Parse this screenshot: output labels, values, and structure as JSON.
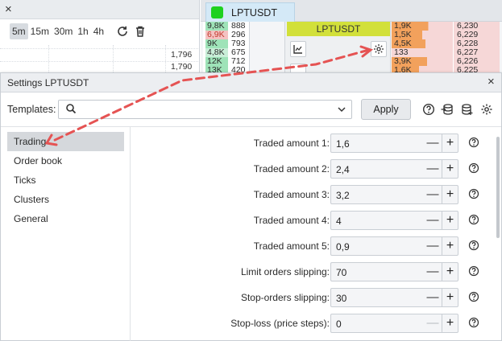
{
  "background": {
    "chart": {
      "close_glyph": "×",
      "timeframes": [
        "5m",
        "15m",
        "30m",
        "1h",
        "4h"
      ],
      "active_timeframe": "5m",
      "price_labels": [
        "1,796",
        "1,790"
      ]
    },
    "dom": {
      "tab_label": "LPTUSDT",
      "tab_color": "#1fd11f",
      "left_rows": [
        {
          "a": "9,8K",
          "b": "888",
          "bg": "#9ee3b8"
        },
        {
          "a": "6,9K",
          "b": "296",
          "bg": "#f4c2c2",
          "color": "#c0392b"
        },
        {
          "a": "9K",
          "b": "793",
          "bg": "#9ee3b8"
        },
        {
          "a": "4,8K",
          "b": "675",
          "bg": "#c9eed8"
        },
        {
          "a": "12K",
          "b": "712",
          "bg": "#9ee3b8"
        },
        {
          "a": "13K",
          "b": "420",
          "bg": "#9ee3b8"
        }
      ],
      "mid_title": "LPTUSDT",
      "right_rows": [
        {
          "a": "1,9K",
          "b": "6,230",
          "w": 0.6
        },
        {
          "a": "1,5K",
          "b": "6,229",
          "w": 0.5
        },
        {
          "a": "4,5K",
          "b": "6,228",
          "w": 0.55
        },
        {
          "a": "133",
          "b": "6,227",
          "w": 0.0
        },
        {
          "a": "3,9K",
          "b": "6,226",
          "w": 0.58
        },
        {
          "a": "1,6K",
          "b": "6,225",
          "w": 0.45
        }
      ],
      "bar_color": "#f2a15c"
    }
  },
  "dialog": {
    "title": "Settings LPTUSDT",
    "close_glyph": "×",
    "templates_label": "Templates:",
    "template_value": "",
    "apply_label": "Apply",
    "nav": [
      {
        "label": "Trading",
        "active": true
      },
      {
        "label": "Order book",
        "active": false
      },
      {
        "label": "Ticks",
        "active": false
      },
      {
        "label": "Clusters",
        "active": false
      },
      {
        "label": "General",
        "active": false
      }
    ],
    "fields": [
      {
        "label": "Traded amount  1:",
        "value": "1,6",
        "minus_disabled": false
      },
      {
        "label": "Traded amount  2:",
        "value": "2,4",
        "minus_disabled": false
      },
      {
        "label": "Traded amount  3:",
        "value": "3,2",
        "minus_disabled": false
      },
      {
        "label": "Traded amount  4:",
        "value": "4",
        "minus_disabled": false
      },
      {
        "label": "Traded amount  5:",
        "value": "0,9",
        "minus_disabled": false
      },
      {
        "label": "Limit orders slipping:",
        "value": "70",
        "minus_disabled": false
      },
      {
        "label": "Stop-orders slipping:",
        "value": "30",
        "minus_disabled": false
      },
      {
        "label": "Stop-loss (price steps):",
        "value": "0",
        "minus_disabled": true
      }
    ],
    "minus_glyph": "—",
    "plus_glyph": "+",
    "annotation_color": "#e55353"
  }
}
